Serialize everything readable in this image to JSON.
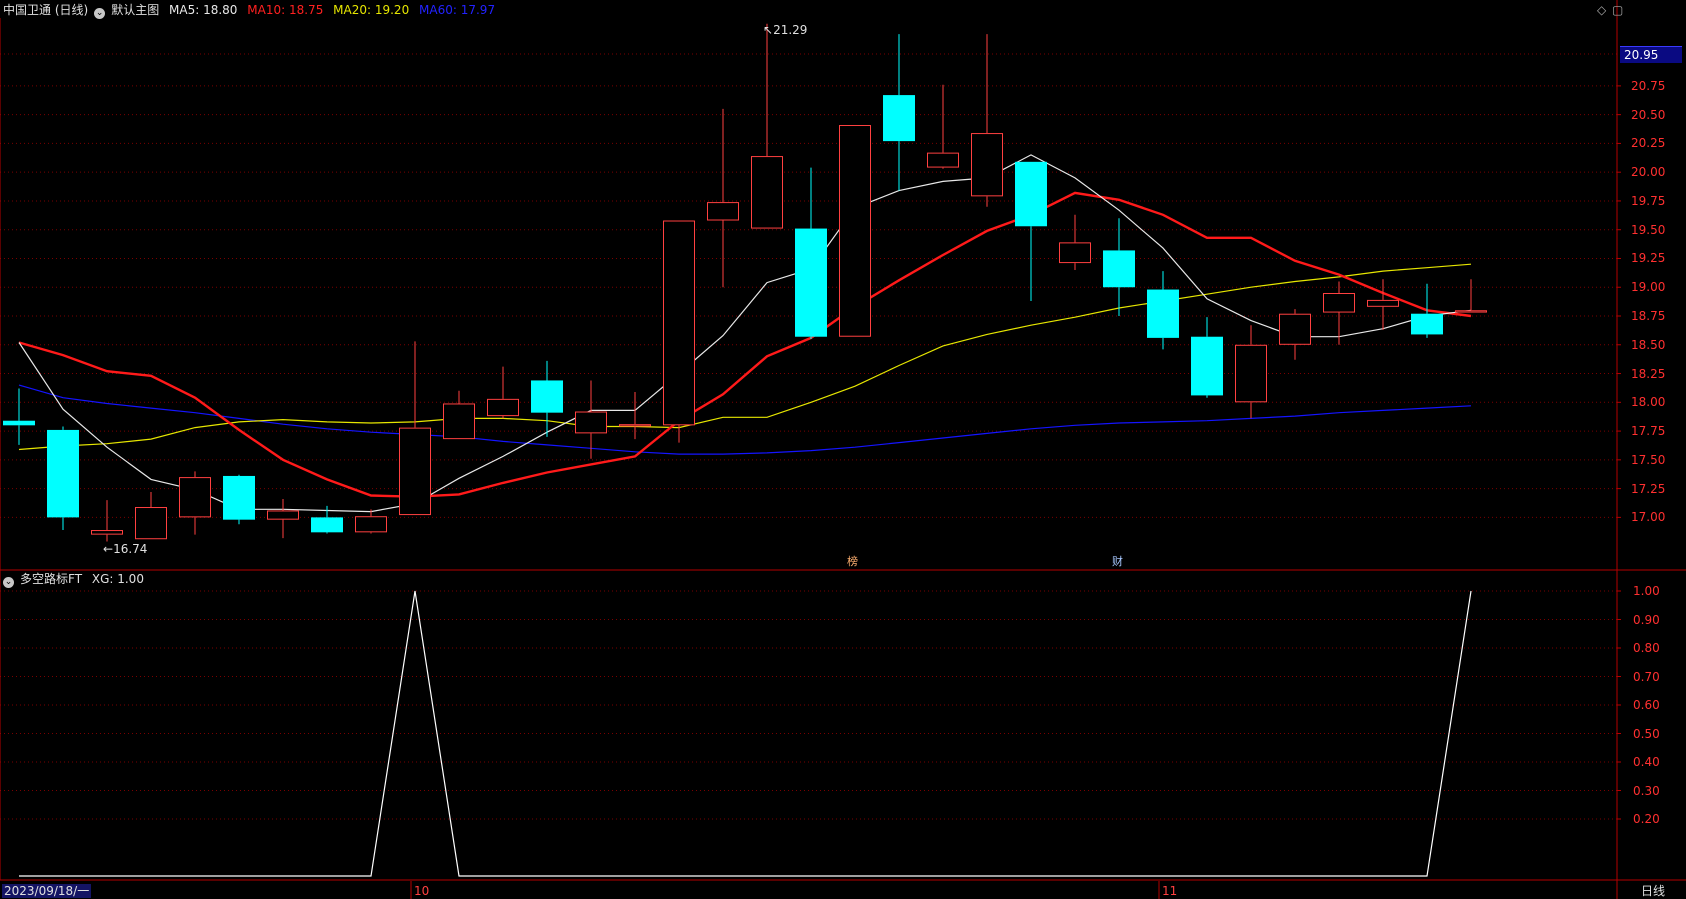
{
  "header": {
    "stock_name": "中国卫通 (日线)",
    "main_chart_label": "默认主图",
    "ma5": "MA5: 18.80",
    "ma10": "MA10: 18.75",
    "ma20": "MA20: 19.20",
    "ma60": "MA60: 17.97"
  },
  "indicator": {
    "name": "多空路标FT",
    "value": "XG: 1.00"
  },
  "price_axis": {
    "current_price": "20.95",
    "ticks": [
      "20.75",
      "20.50",
      "20.25",
      "20.00",
      "19.75",
      "19.50",
      "19.25",
      "19.00",
      "18.75",
      "18.50",
      "18.25",
      "18.00",
      "17.75",
      "17.50",
      "17.25",
      "17.00"
    ]
  },
  "indicator_axis": {
    "ticks": [
      "1.00",
      "0.90",
      "0.80",
      "0.70",
      "0.60",
      "0.50",
      "0.40",
      "0.30",
      "0.20"
    ]
  },
  "annotations": {
    "high_marker": "21.29",
    "low_marker": "16.74",
    "event_1": "榜",
    "event_2": "财"
  },
  "time_axis": {
    "start_date": "2023/09/18/一",
    "month_10": "10",
    "month_11": "11",
    "period": "日线"
  },
  "colors": {
    "background": "#000000",
    "up_candle": "#ff4040",
    "down_candle": "#00ffff",
    "ma5": "#e8e8e8",
    "ma10": "#ff1a1a",
    "ma20": "#e6e600",
    "ma60": "#1414ff",
    "axis": "#b40000",
    "grid": "#7a0000",
    "indicator_line": "#ffffff"
  },
  "chart_data": {
    "type": "candlestick",
    "candles": [
      {
        "open": 17.84,
        "close": 17.8,
        "high": 18.12,
        "low": 17.63
      },
      {
        "open": 17.76,
        "close": 17.0,
        "high": 17.79,
        "low": 16.89
      },
      {
        "open": 16.85,
        "close": 16.89,
        "high": 17.15,
        "low": 16.79
      },
      {
        "open": 16.81,
        "close": 17.09,
        "high": 17.22,
        "low": 16.81
      },
      {
        "open": 17.0,
        "close": 17.35,
        "high": 17.4,
        "low": 16.85
      },
      {
        "open": 17.36,
        "close": 16.98,
        "high": 17.37,
        "low": 16.94
      },
      {
        "open": 16.98,
        "close": 17.06,
        "high": 17.16,
        "low": 16.82
      },
      {
        "open": 17.0,
        "close": 16.87,
        "high": 17.1,
        "low": 16.86
      },
      {
        "open": 16.87,
        "close": 17.01,
        "high": 17.07,
        "low": 16.86
      },
      {
        "open": 17.02,
        "close": 17.78,
        "high": 18.53,
        "low": 17.02
      },
      {
        "open": 17.68,
        "close": 17.99,
        "high": 18.1,
        "low": 17.68
      },
      {
        "open": 17.88,
        "close": 18.03,
        "high": 18.31,
        "low": 17.86
      },
      {
        "open": 18.19,
        "close": 17.91,
        "high": 18.36,
        "low": 17.7
      },
      {
        "open": 17.73,
        "close": 17.92,
        "high": 18.19,
        "low": 17.51
      },
      {
        "open": 17.79,
        "close": 17.81,
        "high": 18.09,
        "low": 17.68
      },
      {
        "open": 17.8,
        "close": 19.58,
        "high": 19.58,
        "low": 17.65
      },
      {
        "open": 19.58,
        "close": 19.74,
        "high": 20.55,
        "low": 19.0
      },
      {
        "open": 19.51,
        "close": 20.14,
        "high": 21.29,
        "low": 19.51
      },
      {
        "open": 19.51,
        "close": 18.57,
        "high": 20.04,
        "low": 18.55
      },
      {
        "open": 18.57,
        "close": 20.41,
        "high": 20.41,
        "low": 18.57
      },
      {
        "open": 20.67,
        "close": 20.27,
        "high": 21.2,
        "low": 19.84
      },
      {
        "open": 20.04,
        "close": 20.17,
        "high": 20.76,
        "low": 20.03
      },
      {
        "open": 19.79,
        "close": 20.34,
        "high": 21.2,
        "low": 19.7
      },
      {
        "open": 20.09,
        "close": 19.53,
        "high": 20.09,
        "low": 18.88
      },
      {
        "open": 19.21,
        "close": 19.39,
        "high": 19.63,
        "low": 19.15
      },
      {
        "open": 19.32,
        "close": 19.0,
        "high": 19.6,
        "low": 18.75
      },
      {
        "open": 18.98,
        "close": 18.56,
        "high": 19.14,
        "low": 18.46
      },
      {
        "open": 18.57,
        "close": 18.06,
        "high": 18.74,
        "low": 18.04
      },
      {
        "open": 18.0,
        "close": 18.5,
        "high": 18.67,
        "low": 17.86
      },
      {
        "open": 18.5,
        "close": 18.77,
        "high": 18.81,
        "low": 18.37
      },
      {
        "open": 18.78,
        "close": 18.95,
        "high": 19.05,
        "low": 18.5
      },
      {
        "open": 18.83,
        "close": 18.89,
        "high": 19.07,
        "low": 18.63
      },
      {
        "open": 18.77,
        "close": 18.59,
        "high": 19.03,
        "low": 18.56
      },
      {
        "open": 18.78,
        "close": 18.8,
        "high": 19.07,
        "low": 18.78
      }
    ],
    "ma5": [
      18.52,
      17.94,
      17.61,
      17.33,
      17.24,
      17.07,
      17.07,
      17.06,
      17.05,
      17.12,
      17.34,
      17.53,
      17.74,
      17.93,
      17.93,
      18.25,
      18.58,
      19.04,
      19.16,
      19.69,
      19.84,
      19.92,
      19.95,
      20.15,
      19.95,
      19.67,
      19.34,
      18.9,
      18.71,
      18.57,
      18.57,
      18.64,
      18.75,
      18.8
    ],
    "ma10": [
      18.52,
      18.41,
      18.27,
      18.23,
      18.04,
      17.76,
      17.5,
      17.33,
      17.19,
      17.18,
      17.2,
      17.3,
      17.39,
      17.46,
      17.53,
      17.84,
      18.07,
      18.4,
      18.56,
      18.83,
      19.06,
      19.28,
      19.49,
      19.63,
      19.82,
      19.76,
      19.63,
      19.43,
      19.43,
      19.23,
      19.11,
      18.95,
      18.8,
      18.75
    ],
    "ma20": [
      17.59,
      17.62,
      17.64,
      17.68,
      17.78,
      17.83,
      17.85,
      17.83,
      17.82,
      17.83,
      17.86,
      17.86,
      17.84,
      17.79,
      17.79,
      17.78,
      17.87,
      17.87,
      18.0,
      18.14,
      18.32,
      18.49,
      18.59,
      18.67,
      18.74,
      18.82,
      18.88,
      18.94,
      19.0,
      19.05,
      19.09,
      19.14,
      19.17,
      19.2
    ],
    "ma60": [
      18.15,
      18.04,
      17.99,
      17.95,
      17.91,
      17.86,
      17.81,
      17.77,
      17.74,
      17.72,
      17.7,
      17.66,
      17.63,
      17.6,
      17.57,
      17.55,
      17.55,
      17.56,
      17.58,
      17.61,
      17.65,
      17.69,
      17.73,
      17.77,
      17.8,
      17.82,
      17.83,
      17.84,
      17.86,
      17.88,
      17.91,
      17.93,
      17.95,
      17.97
    ],
    "indicator_xg": [
      0,
      0,
      0,
      0,
      0,
      0,
      0,
      0,
      0,
      1,
      0,
      0,
      0,
      0,
      0,
      0,
      0,
      0,
      0,
      0,
      0,
      0,
      0,
      0,
      0,
      0,
      0,
      0,
      0,
      0,
      0,
      0,
      0,
      1
    ],
    "price_range": [
      16.56,
      21.34
    ],
    "indicator_range": [
      0,
      1
    ]
  }
}
